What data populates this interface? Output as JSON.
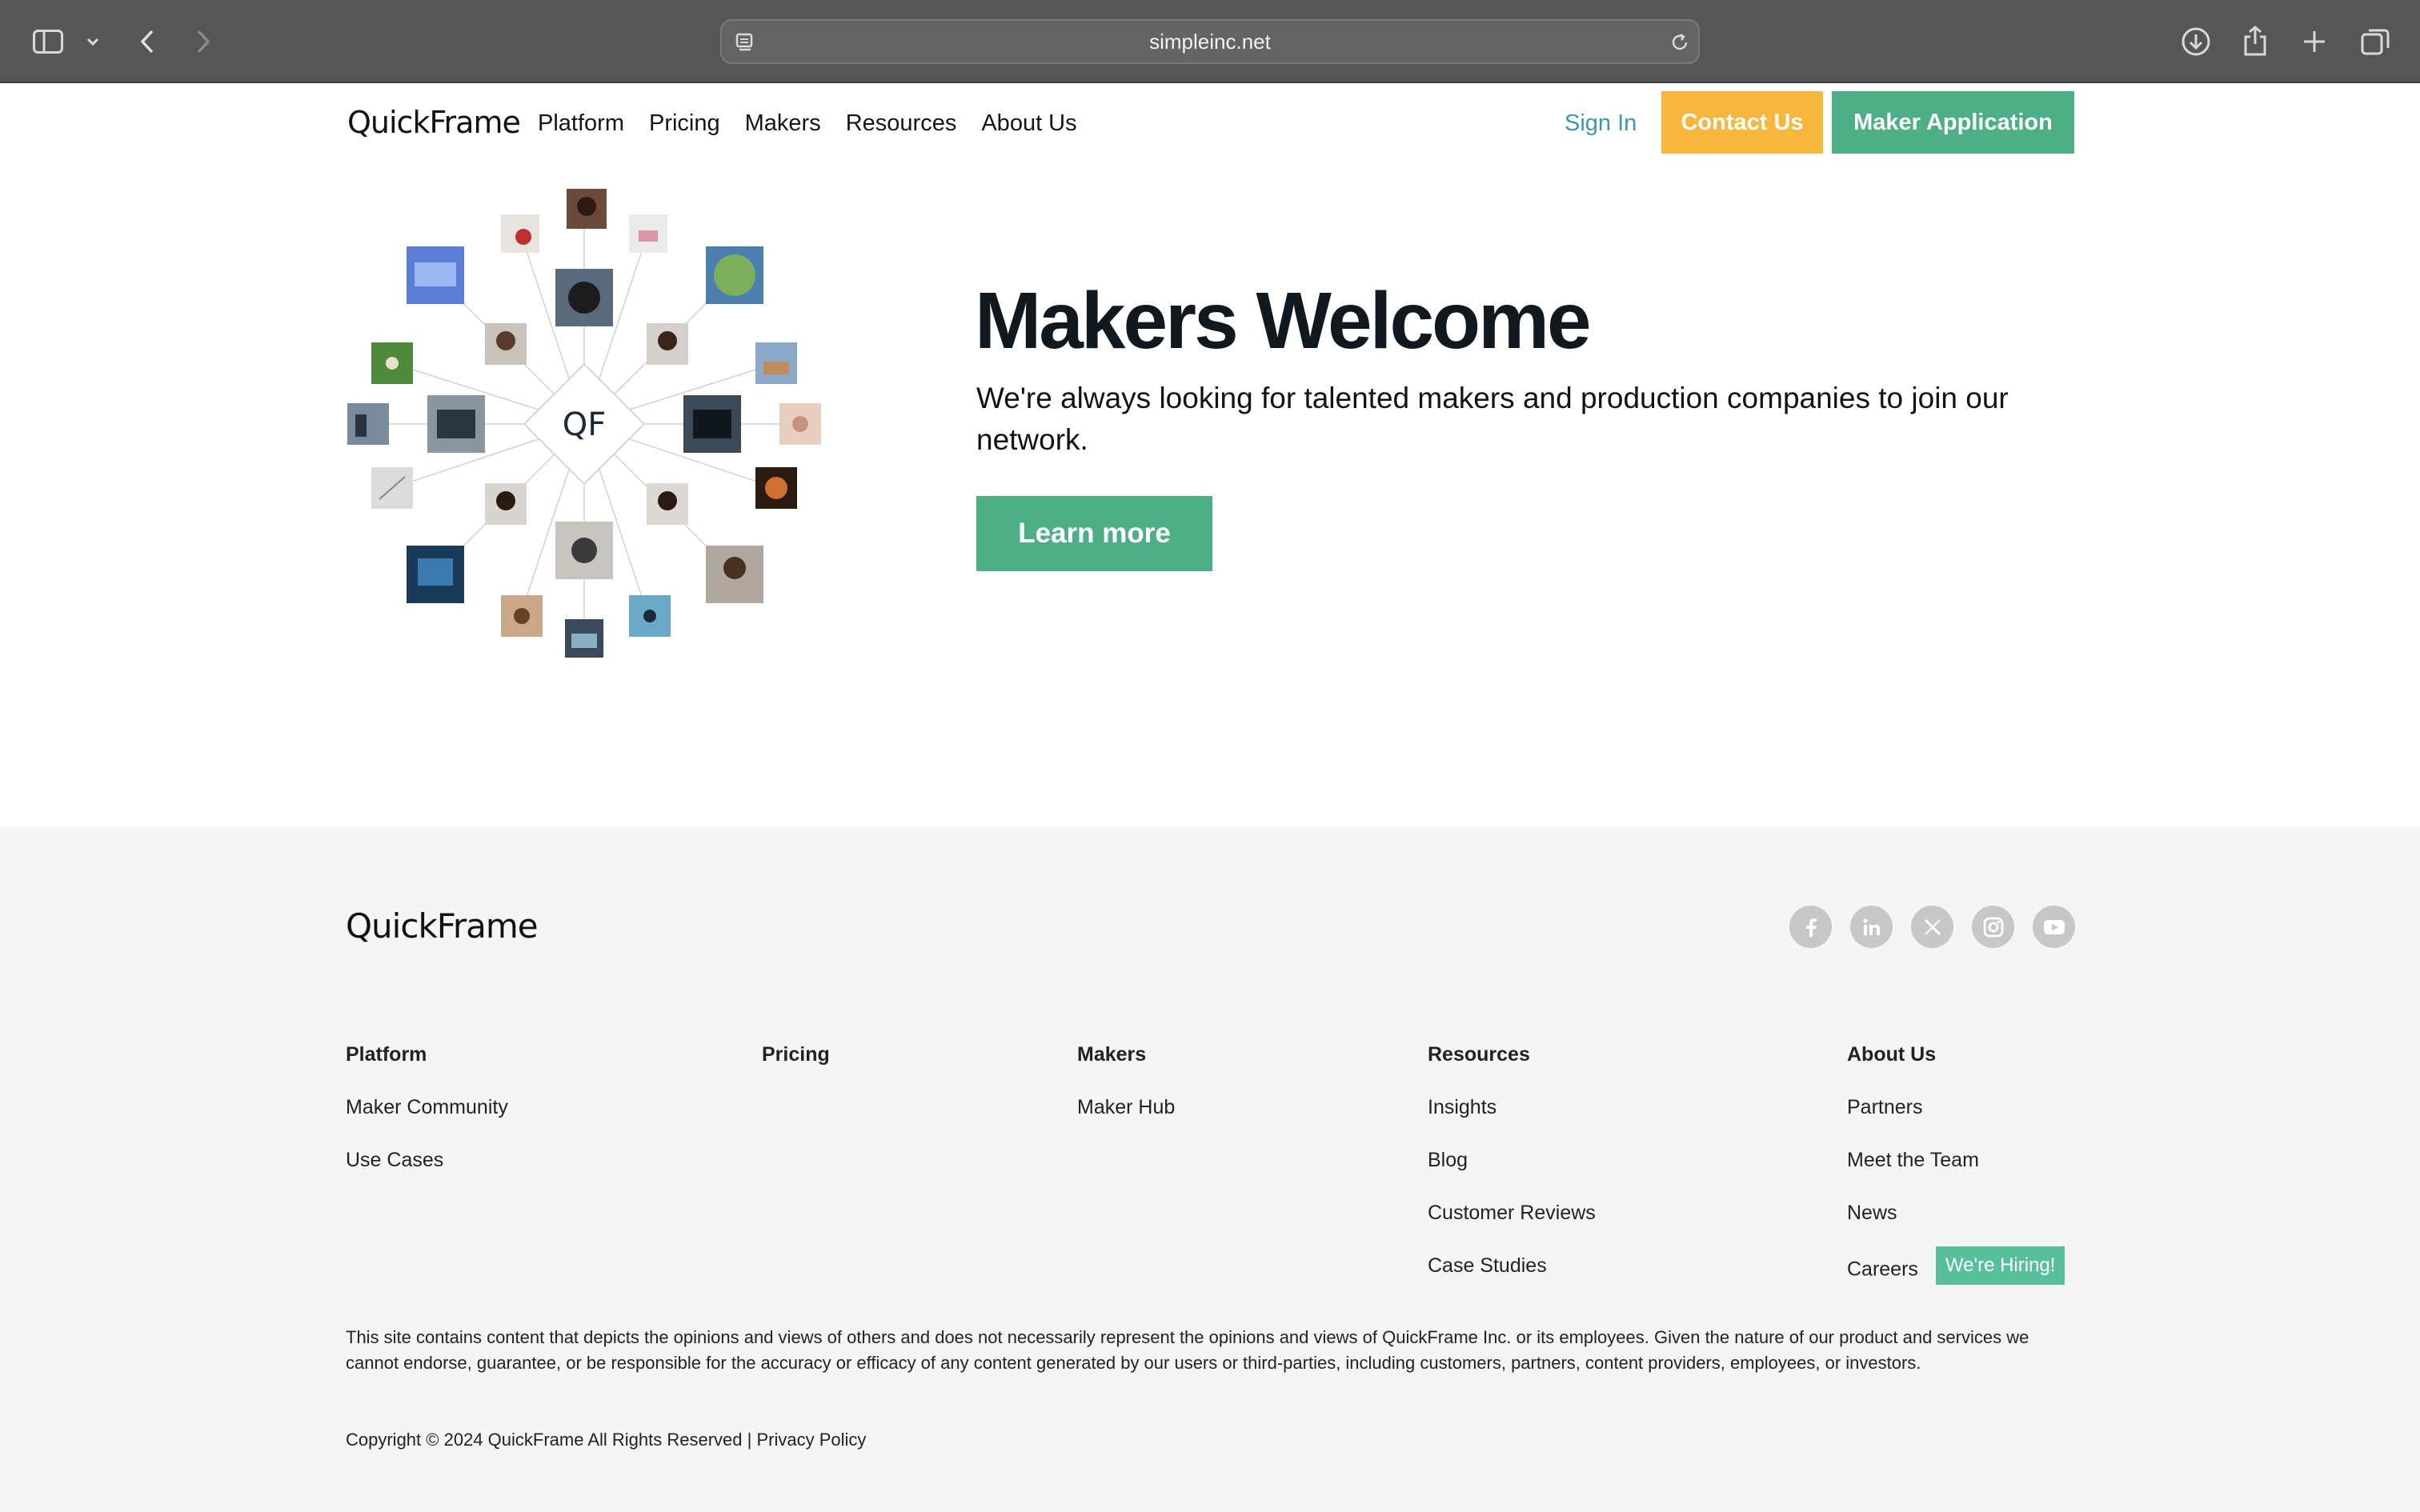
{
  "browser": {
    "url": "simpleinc.net"
  },
  "header": {
    "logo": "QuickFrame",
    "nav": [
      "Platform",
      "Pricing",
      "Makers",
      "Resources",
      "About Us"
    ],
    "sign_in": "Sign In",
    "contact": "Contact Us",
    "maker_application": "Maker Application"
  },
  "hero": {
    "graphic_center": "QF",
    "title": "Makers Welcome",
    "subtitle": "We're always looking for talented makers and production companies to join our network.",
    "cta": "Learn more",
    "colors": {
      "primary": "#4daf86",
      "accent": "#f6b73c",
      "link": "#3a97b8"
    }
  },
  "footer": {
    "logo": "QuickFrame",
    "social": [
      "facebook-icon",
      "linkedin-icon",
      "x-icon",
      "instagram-icon",
      "youtube-icon"
    ],
    "columns": [
      {
        "heading": "Platform",
        "links": [
          "Maker Community",
          "Use Cases"
        ]
      },
      {
        "heading": "Pricing",
        "links": []
      },
      {
        "heading": "Makers",
        "links": [
          "Maker Hub"
        ]
      },
      {
        "heading": "Resources",
        "links": [
          "Insights",
          "Blog",
          "Customer Reviews",
          "Case Studies"
        ]
      },
      {
        "heading": "About Us",
        "links": [
          "Partners",
          "Meet the Team",
          "News",
          "Careers"
        ]
      }
    ],
    "hiring_badge": "We're Hiring!",
    "disclaimer": "This site contains content that depicts the opinions and views of others and does not necessarily represent the opinions and views of QuickFrame Inc. or its employees. Given the nature of our product and services we cannot endorse, guarantee, or be responsible for the accuracy or efficacy of any content generated by our users or third-parties, including customers, partners, content providers, employees, or investors.",
    "copyright": "Copyright © 2024 QuickFrame All Rights Reserved |",
    "privacy": "Privacy Policy"
  }
}
